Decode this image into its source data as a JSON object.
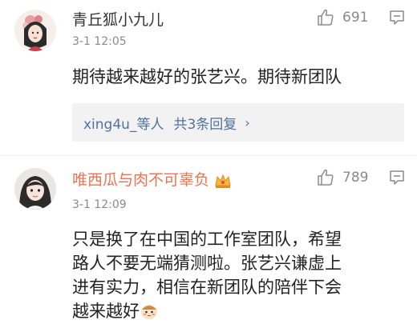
{
  "comments": [
    {
      "username": "青丘狐小九儿",
      "time": "3-1 12:05",
      "likes": "691",
      "text": "期待越来越好的张艺兴。期待新团队",
      "replies": {
        "users": "xing4u_等人",
        "count_label": "共3条回复",
        "chevron": "›"
      },
      "avatar_icon": "illustrated-girl-avatar"
    },
    {
      "username": "唯西瓜与肉不可辜负",
      "time": "3-1 12:09",
      "likes": "789",
      "text_lines": [
        "只是换了在中国的工作室团队，希望",
        "路人不要无端猜测啦。张艺兴谦虚上",
        "进有实力，相信在新团队的陪伴下会",
        "越来越好"
      ],
      "badge_icon": "crown-vip-icon",
      "avatar_icon": "photo-girl-avatar"
    }
  ],
  "colors": {
    "username_default": "#333333",
    "username_vip": "#eb7350",
    "link_blue": "#50729f",
    "meta_gray": "#8a8a8a",
    "reply_bg": "#f2f2f2"
  }
}
